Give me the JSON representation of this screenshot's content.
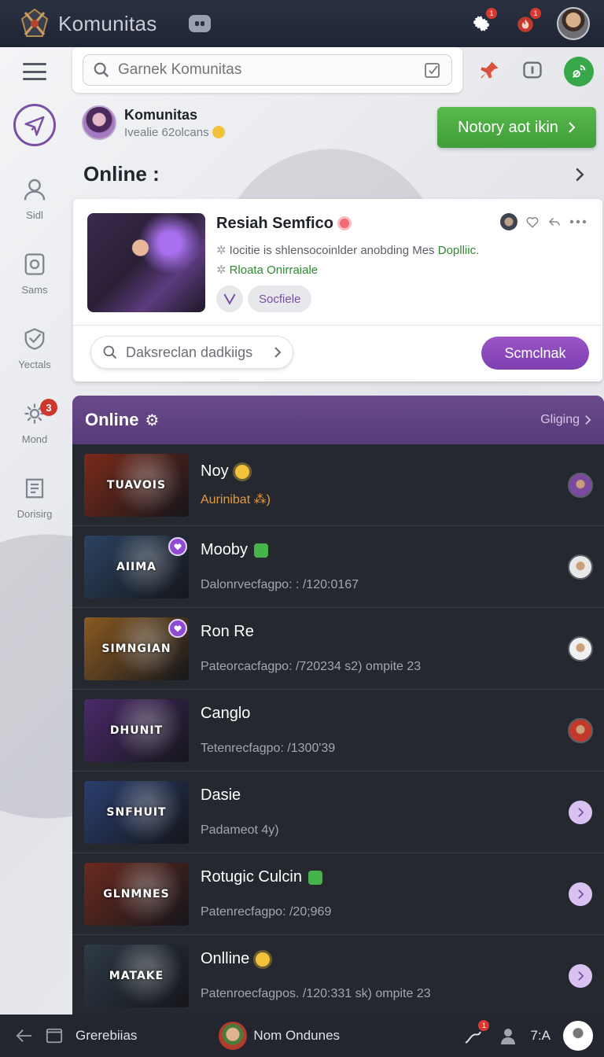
{
  "topbar": {
    "title": "Komunitas",
    "settings_badge": "1",
    "notif_badge": "1"
  },
  "search": {
    "placeholder": "Garnek Komunitas"
  },
  "sidebar": {
    "items": [
      {
        "label": "Sidl",
        "icon": "user-icon"
      },
      {
        "label": "Sams",
        "icon": "badge-icon"
      },
      {
        "label": "Yectals",
        "icon": "shield-check-icon"
      },
      {
        "label": "Mond",
        "icon": "gear-icon",
        "badge": "3"
      },
      {
        "label": "Dorisirg",
        "icon": "book-icon"
      }
    ]
  },
  "community": {
    "title": "Komunitas",
    "subtitle": "Ivealie 62olcans",
    "action_label": "Notory aot ikin"
  },
  "online_heading": "Online :",
  "featured": {
    "title": "Resiah Semfico",
    "line1_prefix": "Iocitie is shlensocoinlder anobding Mes ",
    "line1_link": "Doplliic.",
    "line2": "Rloata Onirraiale",
    "pill_label": "Socfiele",
    "search_label": "Daksreclan dadkiigs",
    "button_label": "Scmclnak"
  },
  "list": {
    "header_title": "Online",
    "header_link": "Gliging",
    "rows": [
      {
        "name": "Noy",
        "sub": "Aurinibat  ⁂)",
        "thumb_text": "TUAVOIS",
        "thumb_bg": "#7a2a1a",
        "accent": "sun",
        "right": "avatar",
        "sub_style": "orange",
        "avatar_color": "#7b4aa0"
      },
      {
        "name": "Mooby",
        "sub": "Dalonrvecfagpo: : /120:0167",
        "thumb_text": "AIIMA",
        "thumb_bg": "#2b4260",
        "accent": "shield",
        "right": "avatar",
        "avatar_color": "#e8e8e8"
      },
      {
        "name": "Ron Re",
        "sub": "Pateorcacfagpo: /720234 s2) ompite 23",
        "thumb_text": "SIMNGIAN",
        "thumb_bg": "#8a5a22",
        "accent": "",
        "right": "avatar",
        "avatar_color": "#f0f0f0"
      },
      {
        "name": "Canglo",
        "sub": "Tetenrecfagpo: /1300'39",
        "thumb_text": "DHUNIT",
        "thumb_bg": "#4a2a6a",
        "accent": "",
        "right": "avatar",
        "avatar_color": "#c0392b"
      },
      {
        "name": "Dasie",
        "sub": "Padameot  4y)",
        "thumb_text": "SNFHUIT",
        "thumb_bg": "#2a3e6e",
        "accent": "",
        "right": "chevron"
      },
      {
        "name": "Rotugic Culcin",
        "sub": "Patenrecfagpo: /20;969",
        "thumb_text": "GLNMNES",
        "thumb_bg": "#6a2a1e",
        "accent": "shield",
        "right": "chevron"
      },
      {
        "name": "Onlline",
        "sub": "Patenroecfagpos. /120:331 sk) ompite 23",
        "thumb_text": "MATAKE",
        "thumb_bg": "#2e3a46",
        "accent": "sun",
        "right": "chevron"
      }
    ]
  },
  "bottombar": {
    "left_label": "Grerebiias",
    "center_label": "Nom Ondunes",
    "right_label": "7:A",
    "notif_badge": "1"
  },
  "colors": {
    "accent_green": "#3f9e38",
    "accent_purple": "#7e3fb1",
    "list_bg": "#262830",
    "topbar_bg": "#1f2534"
  }
}
